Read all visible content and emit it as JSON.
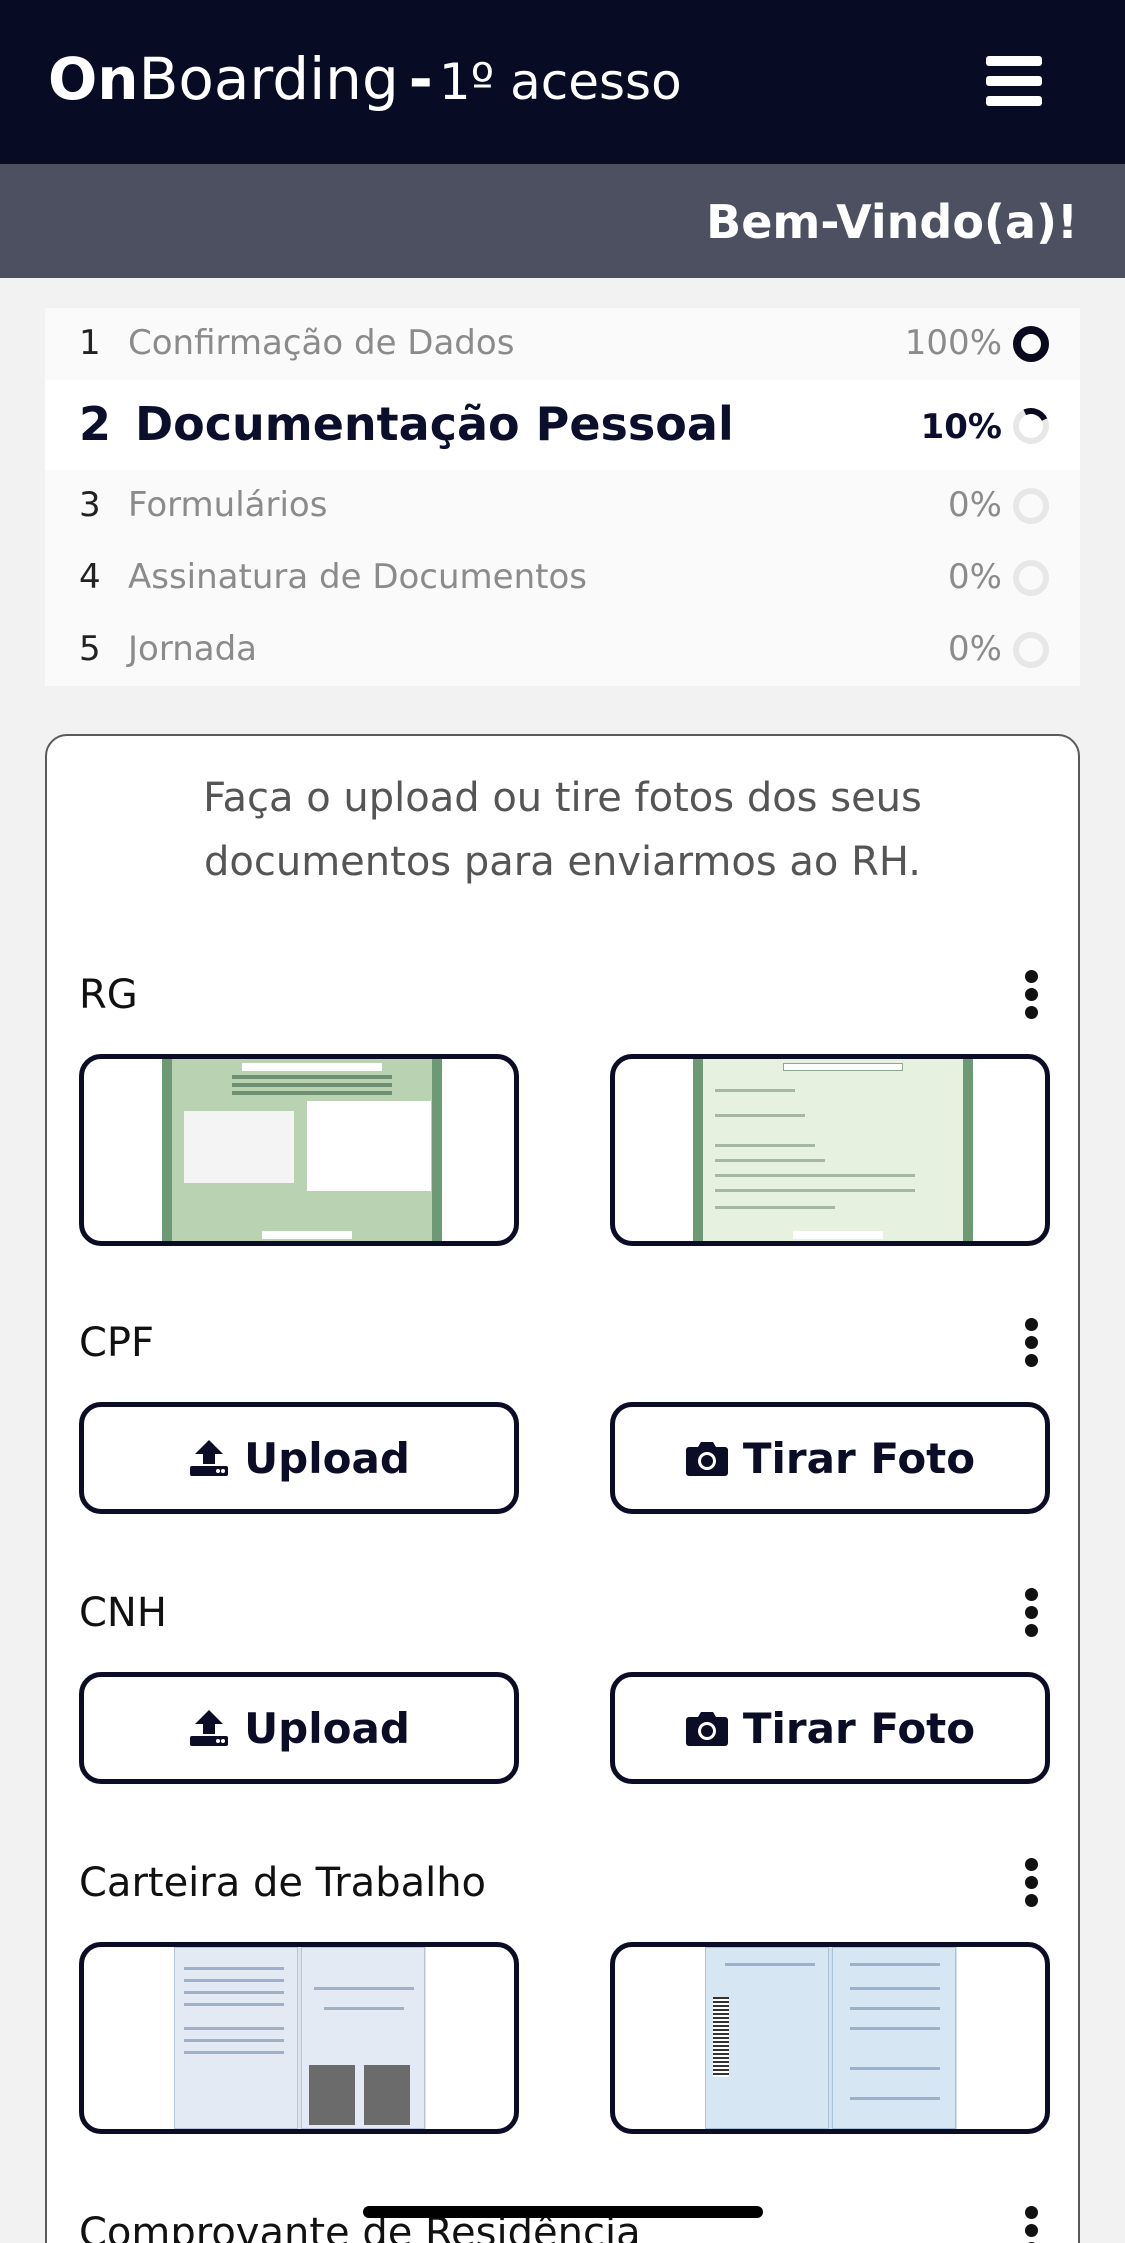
{
  "header": {
    "brand_on": "On",
    "brand_rest": "Boarding",
    "brand_dash": "-",
    "brand_sub": "1º acesso",
    "menu_icon": "hamburger-menu-icon"
  },
  "welcome": "Bem-Vindo(a)!",
  "steps": [
    {
      "num": "1",
      "label": "Confirmação de Dados",
      "percent": "100%",
      "progress": 1.0
    },
    {
      "num": "2",
      "label": "Documentação Pessoal",
      "percent": "10%",
      "progress": 0.1
    },
    {
      "num": "3",
      "label": "Formulários",
      "percent": "0%",
      "progress": 0
    },
    {
      "num": "4",
      "label": "Assinatura de Documentos",
      "percent": "0%",
      "progress": 0
    },
    {
      "num": "5",
      "label": "Jornada",
      "percent": "0%",
      "progress": 0
    }
  ],
  "intro": "Faça o upload ou tire fotos dos seus documentos para enviarmos ao RH.",
  "documents": [
    {
      "title": "RG",
      "state": "uploaded"
    },
    {
      "title": "CPF",
      "upload_label": "Upload",
      "photo_label": "Tirar Foto",
      "state": "empty"
    },
    {
      "title": "CNH",
      "upload_label": "Upload",
      "photo_label": "Tirar Foto",
      "state": "empty"
    },
    {
      "title": "Carteira de Trabalho",
      "state": "uploaded"
    },
    {
      "title": "Comprovante de Residência",
      "state": "partial"
    }
  ]
}
